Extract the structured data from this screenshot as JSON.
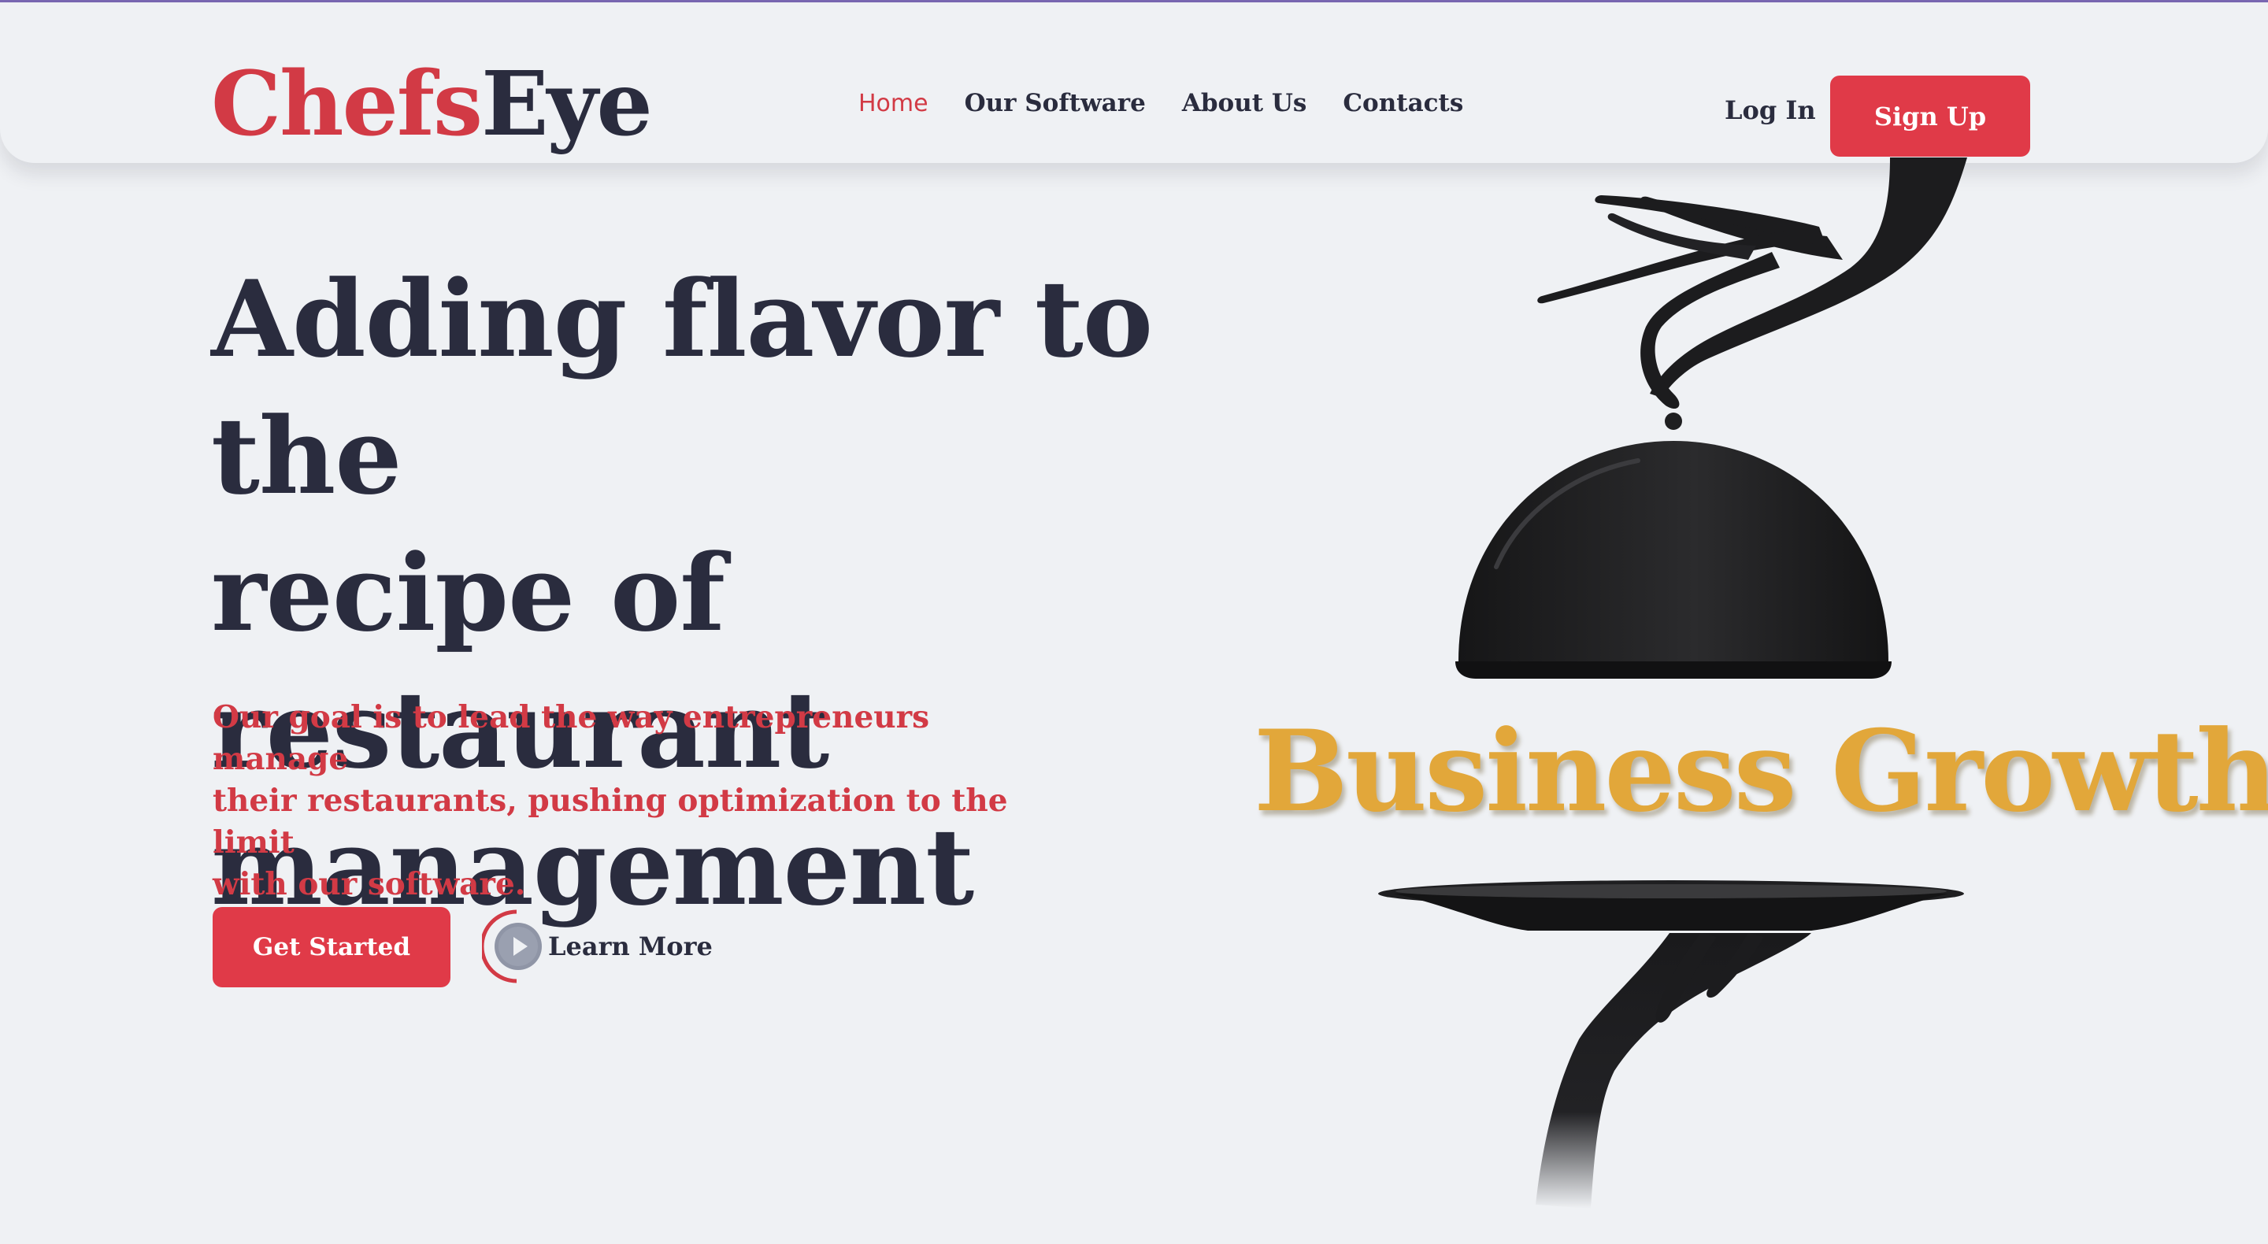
{
  "brand": {
    "logo_part1": "Chefs",
    "logo_part2": "Eye",
    "colors": {
      "accent": "#e03a48",
      "dark": "#2a2c3e",
      "gold": "#e2a73a",
      "background": "#eff1f4"
    }
  },
  "nav": {
    "items": [
      {
        "label": "Home",
        "active": true
      },
      {
        "label": "Our Software",
        "active": false
      },
      {
        "label": "About Us",
        "active": false
      },
      {
        "label": "Contacts",
        "active": false
      }
    ]
  },
  "auth": {
    "login_label": "Log In",
    "signup_label": "Sign Up"
  },
  "hero": {
    "title_line1": "Adding flavor to the",
    "title_line2": "recipe of restaurant",
    "title_line3": "management",
    "subtitle_line1": "Our goal is to lead the way entrepreneurs manage",
    "subtitle_line2": "their restaurants, pushing optimization to the limit",
    "subtitle_line3": "with our software.",
    "cta_label": "Get Started",
    "learn_more_label": "Learn More",
    "learn_more_icon": "play-icon"
  },
  "illustration": {
    "caption": "Business Growth",
    "icons": [
      "hand-icon",
      "cloche-icon",
      "serving-tray-icon"
    ]
  }
}
